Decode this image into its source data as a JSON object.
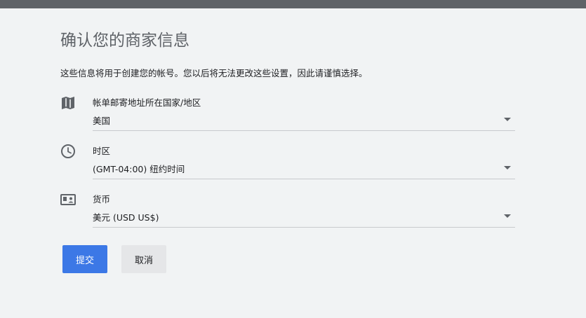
{
  "page": {
    "title": "确认您的商家信息",
    "description": "这些信息将用于创建您的帐号。您以后将无法更改这些设置，因此请谨慎选择。"
  },
  "fields": {
    "country": {
      "label": "帐单邮寄地址所在国家/地区",
      "value": "美国",
      "icon": "map-icon"
    },
    "timezone": {
      "label": "时区",
      "value": "(GMT-04:00) 纽约时间",
      "icon": "clock-icon"
    },
    "currency": {
      "label": "货币",
      "value": "美元 (USD US$)",
      "icon": "currency-icon"
    }
  },
  "actions": {
    "submit_label": "提交",
    "cancel_label": "取消"
  },
  "colors": {
    "primary": "#3c78e6",
    "background": "#f1f3f4",
    "icon": "#5f6368",
    "topbar": "#5f6368"
  }
}
